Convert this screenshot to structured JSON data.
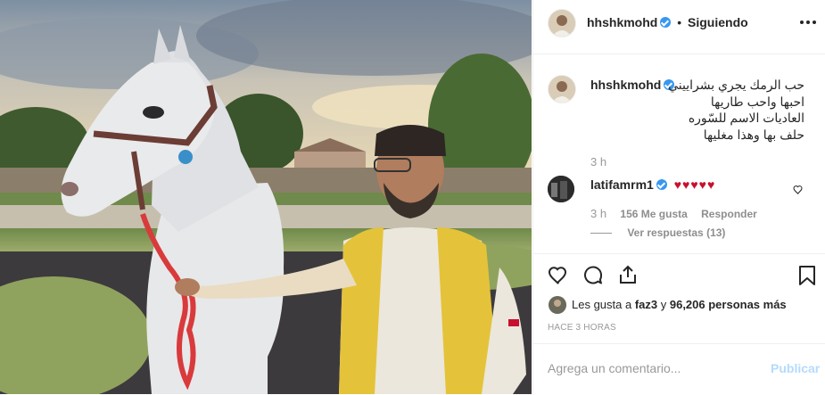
{
  "header": {
    "username": "hhshkmohd",
    "separator": "•",
    "follow_status": "Siguiendo",
    "more_icon": "more-horizontal-icon"
  },
  "caption": {
    "username": "hhshkmohd",
    "lines": [
      "حب الرمك يجري بشراييني",
      "احبها واحب طاريها",
      "العاديات الاسم للسّوره",
      "حلف بها وهذا مغليها"
    ],
    "time": "3 h"
  },
  "comment": {
    "username": "latifamrm1",
    "text": "♥♥♥♥♥",
    "time": "3 h",
    "likes": "156 Me gusta",
    "reply": "Responder",
    "view_replies": "Ver respuestas (13)"
  },
  "actions": {
    "like_icon": "heart-icon",
    "comment_icon": "comment-icon",
    "share_icon": "share-icon",
    "save_icon": "bookmark-icon"
  },
  "likes": {
    "prefix": "Les gusta a ",
    "user": "faz3",
    "middle": " y ",
    "count": "96,206 personas más"
  },
  "timestamp": "HACE 3 HORAS",
  "add_comment": {
    "placeholder": "Agrega un comentario...",
    "publish": "Publicar"
  },
  "colors": {
    "verified": "#3897f0",
    "heart_red": "#ed4956",
    "publish_disabled": "#b3dbff"
  }
}
